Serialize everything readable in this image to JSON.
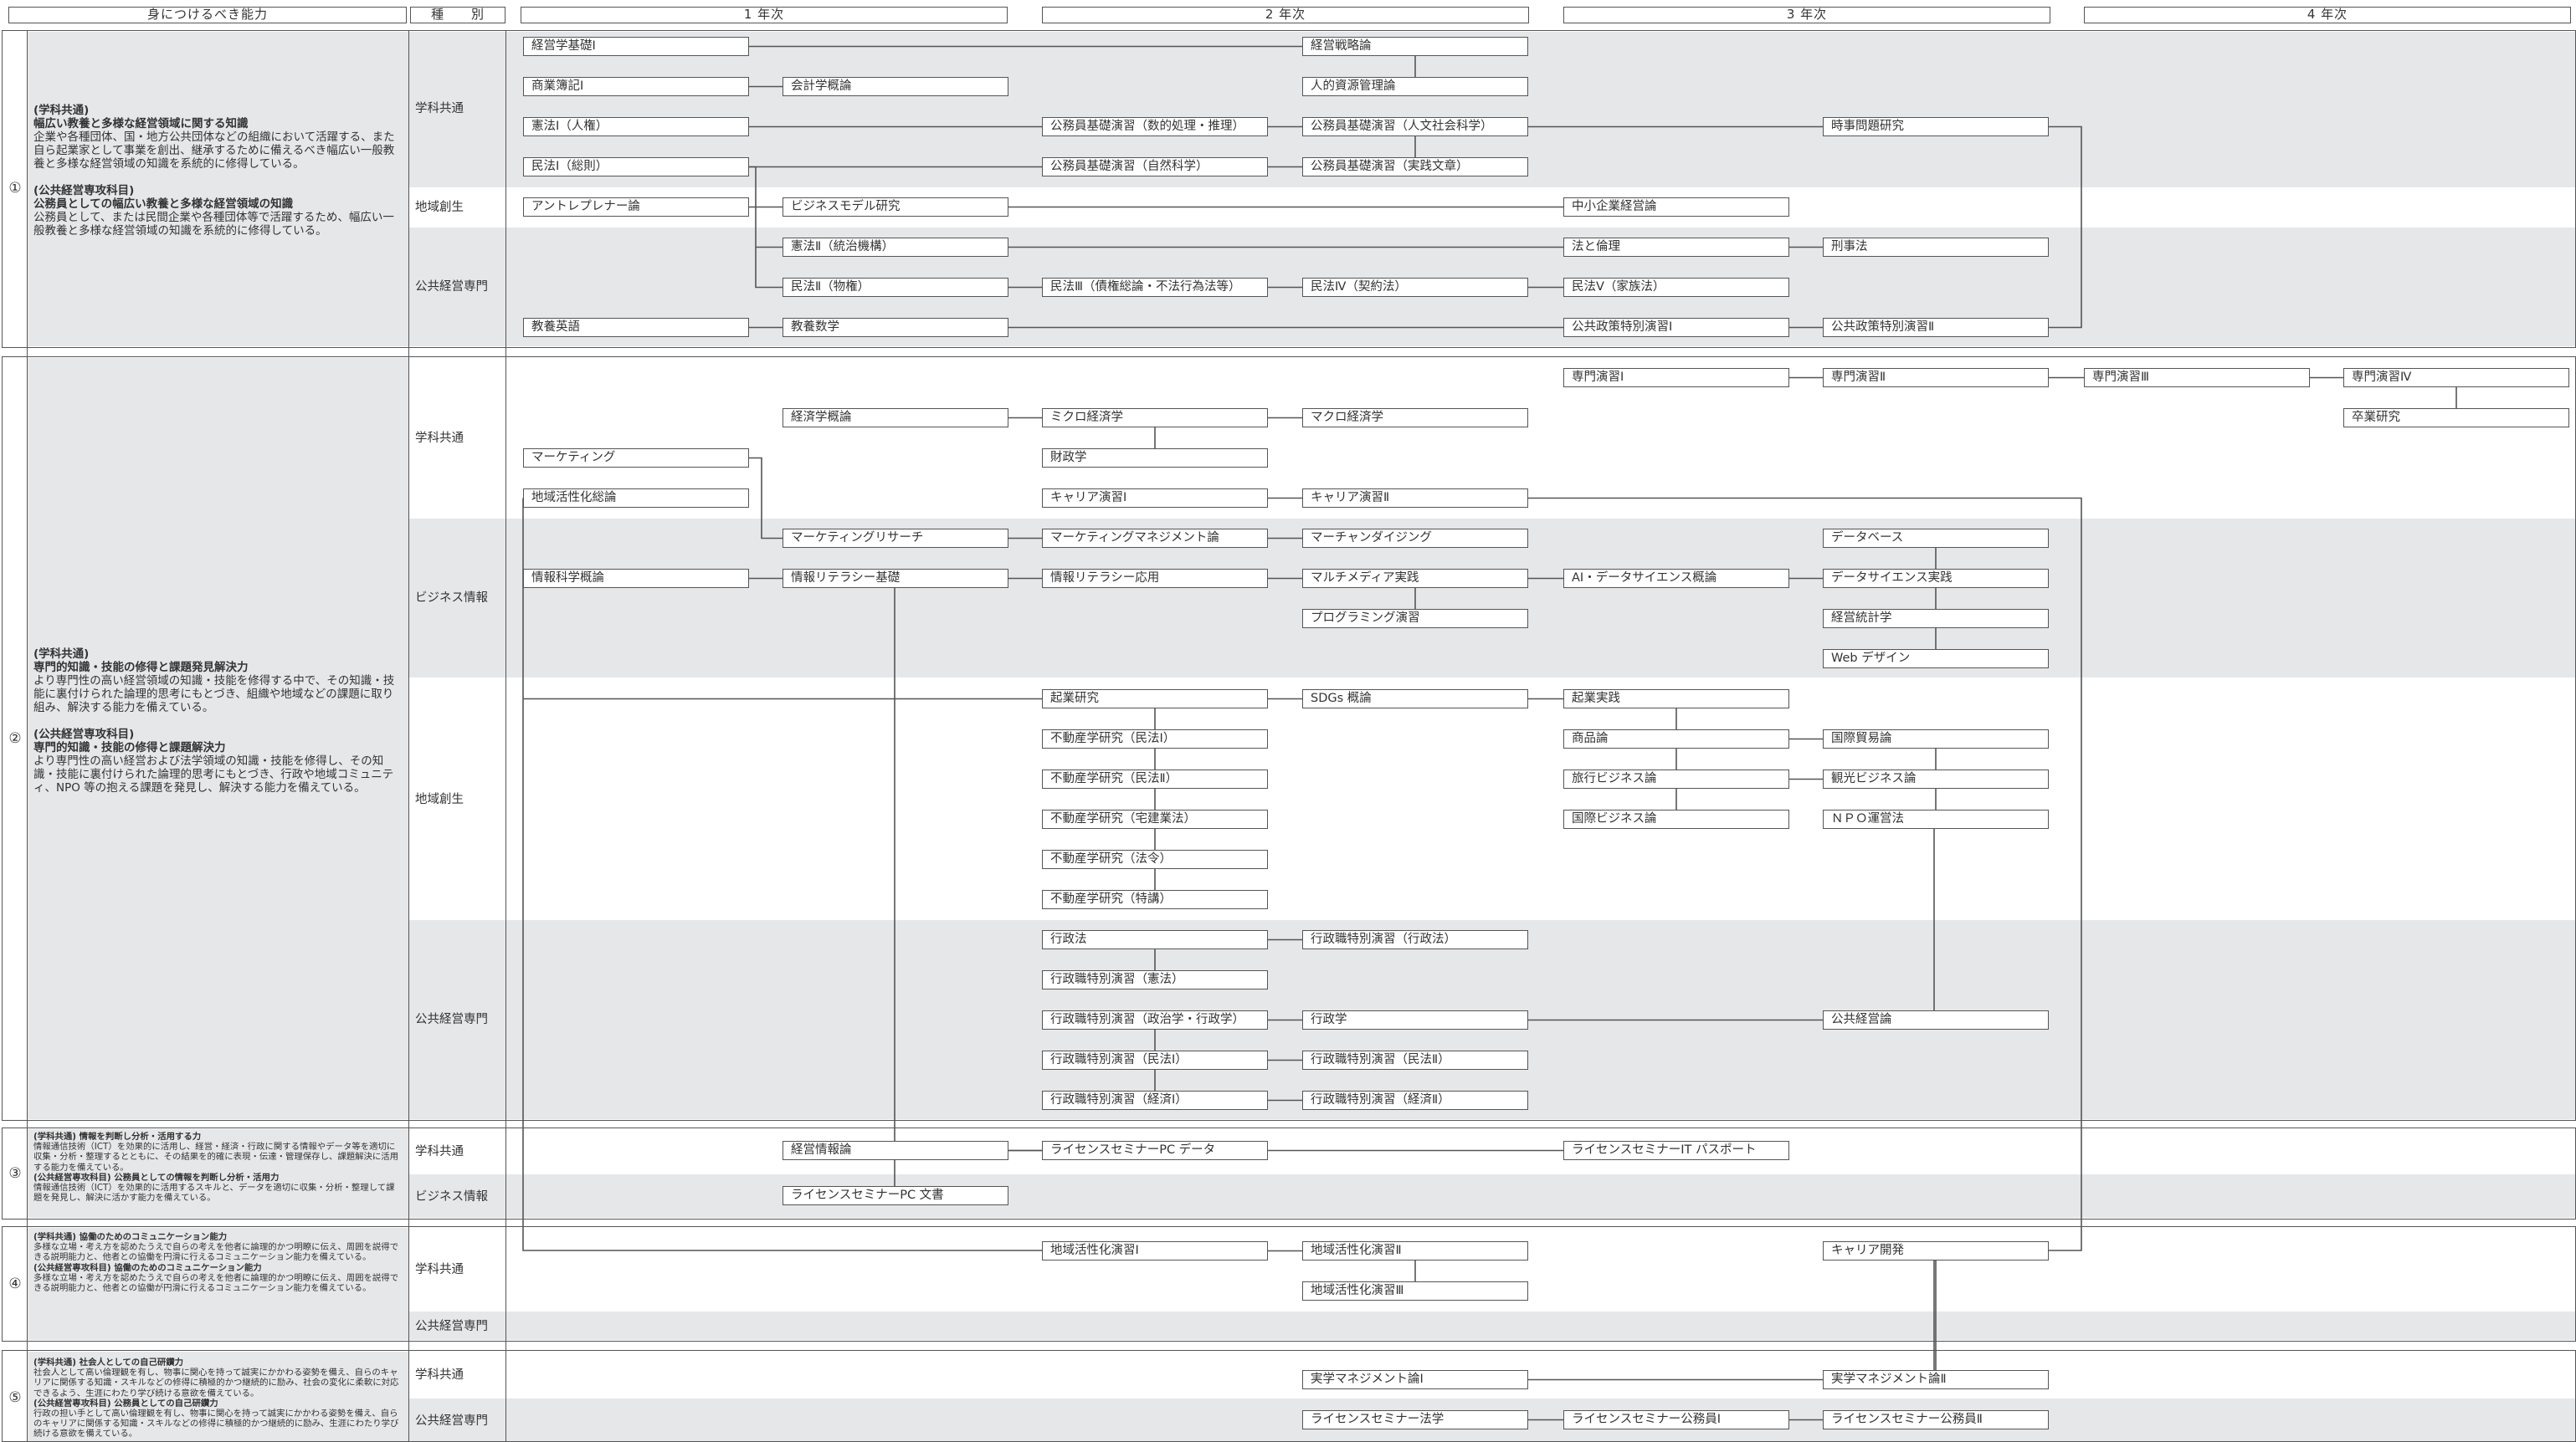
{
  "header": {
    "ability": "身につけるべき能力",
    "type": "種　　別",
    "years": [
      "1 年次",
      "2 年次",
      "3 年次",
      "4 年次"
    ]
  },
  "sections": [
    {
      "num": "①",
      "lines": [
        {
          "t": "(学科共通)",
          "b": true
        },
        {
          "t": "幅広い教養と多様な経営領域に関する知識",
          "b": true
        },
        {
          "t": "企業や各種団体、国・地方公共団体などの組織において活躍する、また自ら起業家として事業を創出、継承するために備えるべき幅広い一般教養と多様な経営領域の知識を系統的に修得している。",
          "b": false
        },
        {
          "t": "(公共経営専攻科目)",
          "b": true,
          "gap": true
        },
        {
          "t": "公務員としての幅広い教養と多様な経営領域の知識",
          "b": true
        },
        {
          "t": "公務員として、または民間企業や各種団体等で活躍するため、幅広い一般教養と多様な経営領域の知識を系統的に修得している。",
          "b": false
        }
      ],
      "categories": [
        "学科共通",
        "地域創生",
        "公共経営専門"
      ]
    },
    {
      "num": "②",
      "lines": [
        {
          "t": "(学科共通)",
          "b": true
        },
        {
          "t": "専門的知識・技能の修得と課題発見解決力",
          "b": true
        },
        {
          "t": "より専門性の高い経営領域の知識・技能を修得する中で、その知識・技能に裏付けられた論理的思考にもとづき、組織や地域などの課題に取り組み、解決する能力を備えている。",
          "b": false
        },
        {
          "t": "(公共経営専攻科目)",
          "b": true,
          "gap": true
        },
        {
          "t": "専門的知識・技能の修得と課題解決力",
          "b": true
        },
        {
          "t": "より専門性の高い経営および法学領域の知識・技能を修得し、その知識・技能に裏付けられた論理的思考にもとづき、行政や地域コミュニティ、NPO 等の抱える課題を発見し、解決する能力を備えている。",
          "b": false
        }
      ],
      "categories": [
        "学科共通",
        "ビジネス情報",
        "地域創生",
        "公共経営専門"
      ]
    },
    {
      "num": "③",
      "lines": [
        {
          "t": "(学科共通) 情報を判断し分析・活用する力",
          "b": true
        },
        {
          "t": "情報通信技術（ICT）を効果的に活用し、経営・経済・行政に関する情報やデータ等を適切に収集・分析・整理するとともに、その結果を的確に表現・伝達・管理保存し、課題解決に活用する能力を備えている。",
          "b": false
        },
        {
          "t": "(公共経営専攻科目) 公務員としての情報を判断し分析・活用力",
          "b": true
        },
        {
          "t": "情報通信技術（ICT）を効果的に活用するスキルと、データを適切に収集・分析・整理して課題を発見し、解決に活かす能力を備えている。",
          "b": false
        }
      ],
      "categories": [
        "学科共通",
        "ビジネス情報"
      ]
    },
    {
      "num": "④",
      "lines": [
        {
          "t": "(学科共通) 協働のためのコミュニケーション能力",
          "b": true
        },
        {
          "t": "多様な立場・考え方を認めたうえで自らの考えを他者に論理的かつ明瞭に伝え、周囲を説得できる説明能力と、他者との協働を円滑に行えるコミュニケーション能力を備えている。",
          "b": false
        },
        {
          "t": "(公共経営専攻科目) 協働のためのコミュニケーション能力",
          "b": true
        },
        {
          "t": "多様な立場・考え方を認めたうえで自らの考えを他者に論理的かつ明瞭に伝え、周囲を説得できる説明能力と、他者との協働が円滑に行えるコミュニケーション能力を備えている。",
          "b": false
        }
      ],
      "categories": [
        "学科共通",
        "公共経営専門"
      ]
    },
    {
      "num": "⑤",
      "lines": [
        {
          "t": "(学科共通) 社会人としての自己研鑽力",
          "b": true
        },
        {
          "t": "社会人として高い倫理観を有し、物事に関心を持って誠実にかかわる姿勢を備え、自らのキャリアに関係する知識・スキルなどの修得に積極的かつ継続的に励み、社会の変化に柔軟に対応できるよう、生涯にわたり学び続ける意欲を備えている。",
          "b": false
        },
        {
          "t": "(公共経営専攻科目) 公務員としての自己研鑽力",
          "b": true
        },
        {
          "t": "行政の担い手として高い倫理観を有し、物事に関心を持って誠実にかかわる姿勢を備え、自らのキャリアに関係する知識・スキルなどの修得に積極的かつ継続的に励み、生涯にわたり学び続ける意欲を備えている。",
          "b": false
        }
      ],
      "categories": [
        "学科共通",
        "公共経営専門"
      ]
    }
  ],
  "courses": [
    "経営学基礎Ⅰ",
    "経営戦略論",
    "商業簿記Ⅰ",
    "会計学概論",
    "人的資源管理論",
    "憲法Ⅰ（人権）",
    "公務員基礎演習（数的処理・推理）",
    "公務員基礎演習（人文社会科学）",
    "時事問題研究",
    "民法Ⅰ（総則）",
    "公務員基礎演習（自然科学）",
    "公務員基礎演習（実践文章）",
    "アントレプレナー論",
    "ビジネスモデル研究",
    "中小企業経営論",
    "憲法Ⅱ（統治機構）",
    "法と倫理",
    "刑事法",
    "民法Ⅱ（物権）",
    "民法Ⅲ（債権総論・不法行為法等）",
    "民法Ⅳ（契約法）",
    "民法Ⅴ（家族法）",
    "教養英語",
    "教養数学",
    "公共政策特別演習Ⅰ",
    "公共政策特別演習Ⅱ",
    "専門演習Ⅰ",
    "専門演習Ⅱ",
    "専門演習Ⅲ",
    "専門演習Ⅳ",
    "卒業研究",
    "経済学概論",
    "ミクロ経済学",
    "マクロ経済学",
    "マーケティング",
    "財政学",
    "地域活性化総論",
    "キャリア演習Ⅰ",
    "キャリア演習Ⅱ",
    "マーケティングリサーチ",
    "マーケティングマネジメント論",
    "マーチャンダイジング",
    "データベース",
    "情報科学概論",
    "情報リテラシー基礎",
    "情報リテラシー応用",
    "マルチメディア実践",
    "AI・データサイエンス概論",
    "データサイエンス実践",
    "プログラミング演習",
    "経営統計学",
    "Web デザイン",
    "起業研究",
    "SDGs 概論",
    "起業実践",
    "不動産学研究（民法Ⅰ）",
    "商品論",
    "国際貿易論",
    "不動産学研究（民法Ⅱ）",
    "旅行ビジネス論",
    "観光ビジネス論",
    "不動産学研究（宅建業法）",
    "国際ビジネス論",
    "ＮＰＯ運営法",
    "不動産学研究（法令）",
    "不動産学研究（特講）",
    "行政法",
    "行政職特別演習（行政法）",
    "行政職特別演習（憲法）",
    "行政職特別演習（政治学・行政学）",
    "行政学",
    "公共経営論",
    "行政職特別演習（民法Ⅰ）",
    "行政職特別演習（民法Ⅱ）",
    "行政職特別演習（経済Ⅰ）",
    "行政職特別演習（経済Ⅱ）",
    "経営情報論",
    "ライセンスセミナーPC データ",
    "ライセンスセミナーIT パスポート",
    "ライセンスセミナーPC 文書",
    "地域活性化演習Ⅰ",
    "地域活性化演習Ⅱ",
    "キャリア開発",
    "地域活性化演習Ⅲ",
    "実学マネジメント論Ⅰ",
    "実学マネジメント論Ⅱ",
    "ライセンスセミナー法学",
    "ライセンスセミナー公務員Ⅰ",
    "ライセンスセミナー公務員Ⅱ"
  ]
}
